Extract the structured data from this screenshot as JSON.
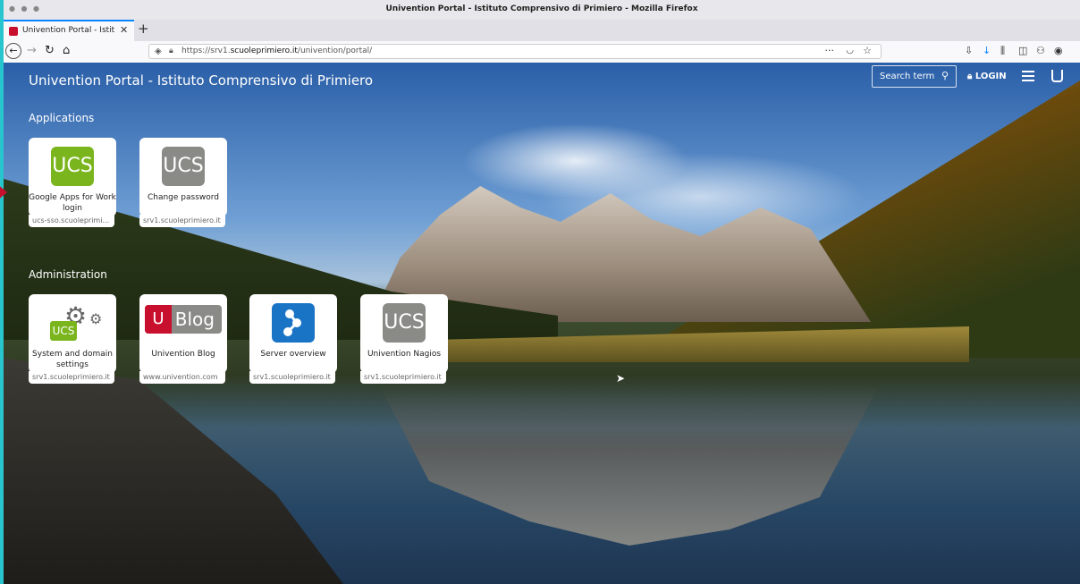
{
  "window": {
    "title": "Univention Portal - Istituto Comprensivo di Primiero - Mozilla Firefox"
  },
  "tab": {
    "label": "Univention Portal - Istitu",
    "close": "✕",
    "new": "+"
  },
  "nav": {
    "url_prefix": "https://srv1.",
    "url_domain": "scuoleprimiero.it",
    "url_path": "/univention/portal/",
    "dots": "···"
  },
  "portal": {
    "title": "Univention Portal - Istituto Comprensivo di Primiero",
    "search_placeholder": "Search term",
    "login_label": "LOGIN"
  },
  "sections": [
    {
      "title": "Applications",
      "tiles": [
        {
          "name": "Google Apps for Work login",
          "host": "ucs-sso.scuoleprimi...",
          "icon": "ucs-green-icon",
          "icon_text": "UCS"
        },
        {
          "name": "Change password",
          "host": "srv1.scuoleprimiero.it",
          "icon": "ucs-grey-icon",
          "icon_text": "UCS"
        }
      ]
    },
    {
      "title": "Administration",
      "tiles": [
        {
          "name": "System and domain settings",
          "host": "srv1.scuoleprimiero.it",
          "icon": "gears-icon",
          "icon_text": "UCS"
        },
        {
          "name": "Univention Blog",
          "host": "www.univention.com",
          "icon": "blog-icon",
          "icon_text": "Blog",
          "logo_letter": "U"
        },
        {
          "name": "Server overview",
          "host": "srv1.scuoleprimiero.it",
          "icon": "network-icon"
        },
        {
          "name": "Univention Nagios",
          "host": "srv1.scuoleprimiero.it",
          "icon": "ucs-grey-icon",
          "icon_text": "UCS"
        }
      ]
    }
  ],
  "colors": {
    "accent_red": "#c8102e",
    "ucs_green": "#7ab51d",
    "ucs_grey": "#8a8a86",
    "blue": "#1a74c6"
  }
}
